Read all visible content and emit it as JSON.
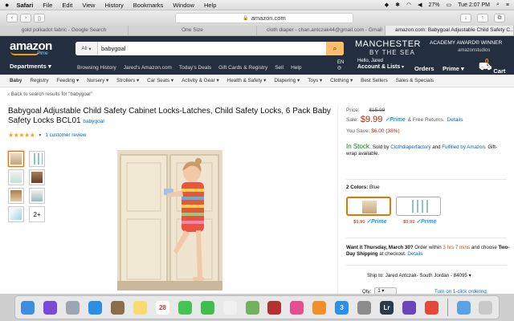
{
  "menubar": {
    "apple": "",
    "items": [
      "Safari",
      "File",
      "Edit",
      "View",
      "History",
      "Bookmarks",
      "Window",
      "Help"
    ],
    "battery": "27%",
    "clock": "Tue 2:07 PM"
  },
  "toolbar": {
    "address": "amazon.com"
  },
  "tabs": [
    {
      "label": "gold polkadot fabric - Google Search"
    },
    {
      "label": "One Size"
    },
    {
      "label": "cloth diaper - chan.antczak44@gmail.com - Gmail"
    },
    {
      "label": "amazon.com: Babygoal Adjustable Child Safety C..."
    }
  ],
  "header": {
    "logo": "amazon",
    "logo_sub": "Prime",
    "search_category": "All",
    "search_query": "babygoal",
    "promo_title": "MANCHESTER",
    "promo_sub": "BY THE SEA",
    "promo_award": "ACADEMY AWARD® WINNER",
    "promo_studio": "amazonstudios",
    "departments": "Departments",
    "nav_links": [
      "Browsing History",
      "Jared's Amazon.com",
      "Today's Deals",
      "Gift Cards & Registry",
      "Sell",
      "Help"
    ],
    "lang": "EN",
    "greeting": "Hello, Jared",
    "account": "Account & Lists",
    "orders": "Orders",
    "prime": "Prime",
    "cart_label": "Cart",
    "cart_count": "0"
  },
  "subnav": [
    "Baby",
    "Registry",
    "Feeding",
    "Nursery",
    "Strollers",
    "Car Seats",
    "Activity & Gear",
    "Health & Safety",
    "Diapering",
    "Toys",
    "Clothing",
    "Best Sellers",
    "Sales & Specials"
  ],
  "product": {
    "back_link": "‹ Back to search results for \"babygoal\"",
    "title": "Babygoal Adjustable Child Safety Cabinet Locks-Latches, Child Safety Locks, 6 Pack Baby Safety Locks BCL01",
    "brand": "babygoal",
    "stars": "★★★★★",
    "reviews": "1 customer review",
    "more_images": "2+"
  },
  "buybox": {
    "list_label": "Price:",
    "list_price": "$15.99",
    "sale_label": "Sale:",
    "sale_price": "$9.99",
    "prime": "✓Prime",
    "free_returns": "& Free Returns.",
    "details": "Details",
    "save_label": "You Save:",
    "savings": "$6.00 (38%)",
    "in_stock": "In Stock.",
    "sold_by": "Sold by",
    "seller": "Clothdiaperfactory",
    "fulfilled_and": "and",
    "fulfilled": "Fulfilled by Amazon.",
    "gift_wrap": "Gift-wrap available.",
    "color_label": "2 Colors:",
    "color_value": "Blue",
    "swatch_price_1": "$9.99",
    "swatch_price_2": "$9.99",
    "swatch_prime": "✓Prime",
    "delivery_want": "Want it Thursday, March 30?",
    "delivery_order": "Order within",
    "delivery_time": "3 hrs 7 mins",
    "delivery_choose": "and choose",
    "delivery_shipping": "Two-Day Shipping",
    "delivery_checkout": "at checkout.",
    "delivery_details": "Details",
    "ship_to": "Ship to: Jared Antczak- South Jordan - 84095 ▾",
    "qty_label": "Qty:",
    "qty_value": "1 ▾",
    "oneclick": "Turn on 1-click ordering"
  },
  "dock": [
    {
      "name": "finder-icon",
      "color": "#3f8de0"
    },
    {
      "name": "siri-icon",
      "color": "#7a49d8"
    },
    {
      "name": "launchpad-icon",
      "color": "#9da6b0"
    },
    {
      "name": "safari-icon",
      "color": "#2b8fe5"
    },
    {
      "name": "photo-icon",
      "color": "#8a6d4e"
    },
    {
      "name": "notes-icon",
      "color": "#f6dc6e"
    },
    {
      "name": "calendar-icon",
      "color": "#ffffff",
      "text": "28"
    },
    {
      "name": "messages-icon",
      "color": "#44c452"
    },
    {
      "name": "facetime-icon",
      "color": "#3fbe4f"
    },
    {
      "name": "photos-icon",
      "color": "#f0f0f0"
    },
    {
      "name": "maps-icon",
      "color": "#72b05c"
    },
    {
      "name": "photo-booth-icon",
      "color": "#b2322f"
    },
    {
      "name": "itunes-icon",
      "color": "#e34f8f"
    },
    {
      "name": "ibooks-icon",
      "color": "#f08e29"
    },
    {
      "name": "app-store-icon",
      "color": "#2d8fed",
      "text": "3"
    },
    {
      "name": "system-preferences-icon",
      "color": "#8c8c8c"
    },
    {
      "name": "lightroom-icon",
      "color": "#2a3b49",
      "text": "Lr"
    },
    {
      "name": "imovie-icon",
      "color": "#6a44b9"
    },
    {
      "name": "chrome-icon",
      "color": "#e5473a"
    },
    {
      "name": "downloads-icon",
      "color": "#5aa2e6"
    },
    {
      "name": "trash-icon",
      "color": "#c8c8c8"
    }
  ]
}
